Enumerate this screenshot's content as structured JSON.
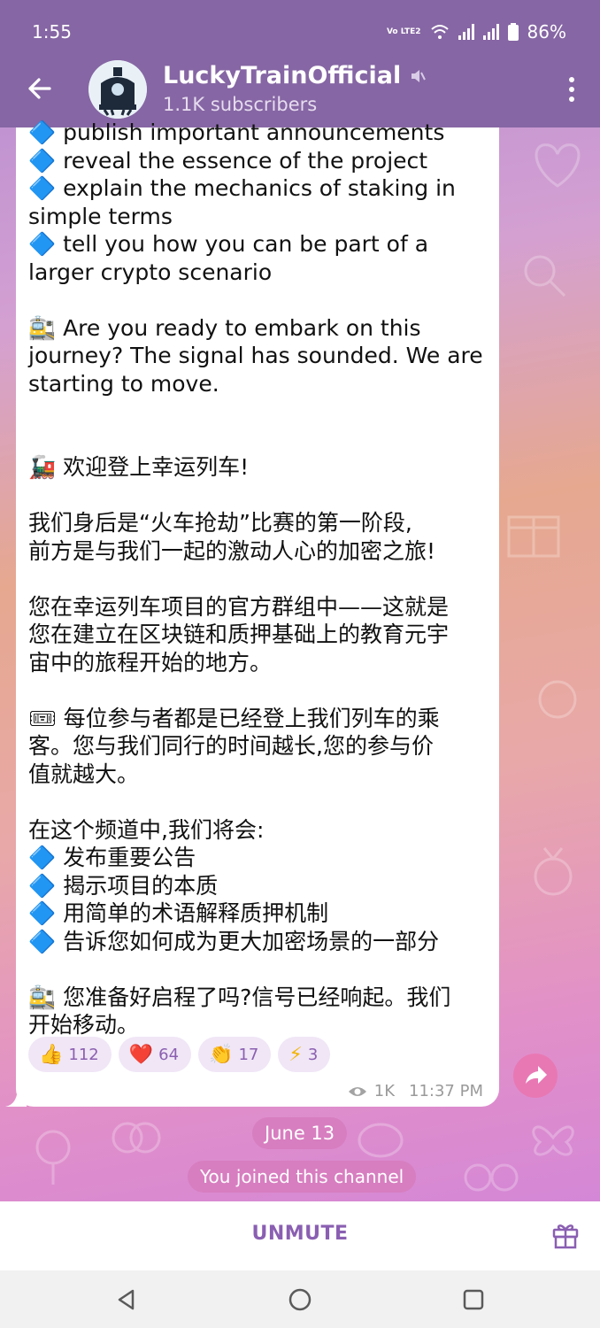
{
  "status": {
    "time": "1:55",
    "network": "Vo LTE2",
    "battery": "86%"
  },
  "channel": {
    "name": "LuckyTrainOfficial",
    "subscribers": "1.1K subscribers"
  },
  "message": {
    "lines": [
      "🔷 publish important announcements",
      "🔷 reveal the essence of the project",
      "🔷 explain the mechanics of staking in",
      "simple terms",
      "🔷 tell you how you can be part of a",
      "larger crypto scenario",
      "",
      "🚉 Are you ready to embark on this",
      "journey? The signal has sounded. We are",
      "starting to move.",
      "",
      "",
      "🚂 欢迎登上幸运列车!",
      "",
      "我们身后是“火车抢劫”比赛的第一阶段,",
      "前方是与我们一起的激动人心的加密之旅!",
      "",
      "您在幸运列车项目的官方群组中——这就是",
      "您在建立在区块链和质押基础上的教育元宇",
      "宙中的旅程开始的地方。",
      "",
      "🎟 每位参与者都是已经登上我们列车的乘",
      "客。您与我们同行的时间越长,您的参与价",
      "值就越大。",
      "",
      "在这个频道中,我们将会:",
      "🔷 发布重要公告",
      "🔷 揭示项目的本质",
      "🔷 用简单的术语解释质押机制",
      "🔷 告诉您如何成为更大加密场景的一部分",
      "",
      "🚉 您准备好启程了吗?信号已经响起。我们",
      "开始移动。"
    ]
  },
  "reactions": [
    {
      "emoji": "👍",
      "count": "112"
    },
    {
      "emoji": "❤️",
      "count": "64"
    },
    {
      "emoji": "👏",
      "count": "17"
    },
    {
      "emoji": "⚡",
      "count": "3"
    }
  ],
  "meta": {
    "views": "1K",
    "time": "11:37 PM"
  },
  "date_pill": "June 13",
  "joined_pill": "You joined this channel",
  "bottom": {
    "unmute_label": "UNMUTE"
  },
  "colors": {
    "header": "#8666a4",
    "accent": "#8a5fb2",
    "pill": "#d77ec0",
    "share": "#e878b4"
  }
}
